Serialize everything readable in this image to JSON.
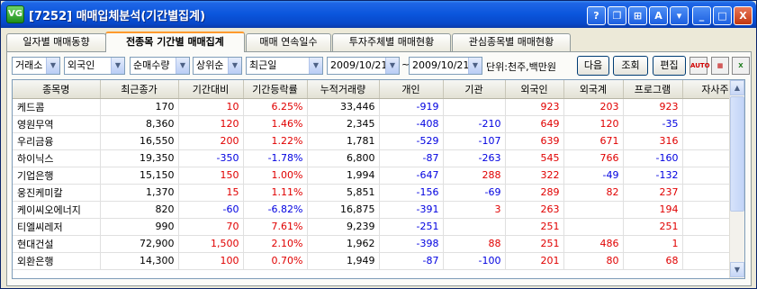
{
  "window": {
    "title": "[7252] 매매입체분석(기간별집계)",
    "app_icon_text": "VG",
    "titlebar_buttons": [
      "?",
      "❐",
      "⊞",
      "A",
      "▾",
      "_",
      "□",
      "X"
    ]
  },
  "tabs": [
    {
      "label": "일자별 매매동향",
      "active": false
    },
    {
      "label": "전종목 기간별 매매집계",
      "active": true
    },
    {
      "label": "매매 연속일수",
      "active": false
    },
    {
      "label": "투자주체별 매매현황",
      "active": false
    },
    {
      "label": "관심종목별 매매현황",
      "active": false
    }
  ],
  "filters": {
    "market": "거래소",
    "investor": "외국인",
    "sort_by": "순매수량",
    "order": "상위순",
    "period": "최근일",
    "date_from": "2009/10/21",
    "date_to": "2009/10/21",
    "tilde": "~",
    "unit_label": "단위:천주,백만원"
  },
  "buttons": {
    "next": "다음",
    "query": "조회",
    "edit": "편집",
    "auto": "AUTO"
  },
  "table": {
    "headers": [
      "종목명",
      "최근종가",
      "기간대비",
      "기간등락률",
      "누적거래량",
      "개인",
      "기관",
      "외국인",
      "외국계",
      "프로그램",
      "자사주"
    ],
    "rows": [
      {
        "name": "케드콤",
        "close": "170",
        "change": "10",
        "rate": "6.25%",
        "volume": "33,446",
        "individual": "-919",
        "institution": "",
        "foreign": "923",
        "foreign_firm": "203",
        "program": "923",
        "treasury": ""
      },
      {
        "name": "영원무역",
        "close": "8,360",
        "change": "120",
        "rate": "1.46%",
        "volume": "2,345",
        "individual": "-408",
        "institution": "-210",
        "foreign": "649",
        "foreign_firm": "120",
        "program": "-35",
        "treasury": ""
      },
      {
        "name": "우리금융",
        "close": "16,550",
        "change": "200",
        "rate": "1.22%",
        "volume": "1,781",
        "individual": "-529",
        "institution": "-107",
        "foreign": "639",
        "foreign_firm": "671",
        "program": "316",
        "treasury": ""
      },
      {
        "name": "하이닉스",
        "close": "19,350",
        "change": "-350",
        "rate": "-1.78%",
        "volume": "6,800",
        "individual": "-87",
        "institution": "-263",
        "foreign": "545",
        "foreign_firm": "766",
        "program": "-160",
        "treasury": ""
      },
      {
        "name": "기업은행",
        "close": "15,150",
        "change": "150",
        "rate": "1.00%",
        "volume": "1,994",
        "individual": "-647",
        "institution": "288",
        "foreign": "322",
        "foreign_firm": "-49",
        "program": "-132",
        "treasury": ""
      },
      {
        "name": "웅진케미칼",
        "close": "1,370",
        "change": "15",
        "rate": "1.11%",
        "volume": "5,851",
        "individual": "-156",
        "institution": "-69",
        "foreign": "289",
        "foreign_firm": "82",
        "program": "237",
        "treasury": ""
      },
      {
        "name": "케이씨오에너지",
        "close": "820",
        "change": "-60",
        "rate": "-6.82%",
        "volume": "16,875",
        "individual": "-391",
        "institution": "3",
        "foreign": "263",
        "foreign_firm": "",
        "program": "194",
        "treasury": ""
      },
      {
        "name": "티엘씨레저",
        "close": "990",
        "change": "70",
        "rate": "7.61%",
        "volume": "9,239",
        "individual": "-251",
        "institution": "",
        "foreign": "251",
        "foreign_firm": "",
        "program": "251",
        "treasury": ""
      },
      {
        "name": "현대건설",
        "close": "72,900",
        "change": "1,500",
        "rate": "2.10%",
        "volume": "1,962",
        "individual": "-398",
        "institution": "88",
        "foreign": "251",
        "foreign_firm": "486",
        "program": "1",
        "treasury": ""
      },
      {
        "name": "외환은행",
        "close": "14,300",
        "change": "100",
        "rate": "0.70%",
        "volume": "1,949",
        "individual": "-87",
        "institution": "-100",
        "foreign": "201",
        "foreign_firm": "80",
        "program": "68",
        "treasury": ""
      }
    ]
  },
  "colors": {
    "positive": "#e00000",
    "negative": "#0000e0",
    "titlebar": "#0a55dc",
    "active_tab_accent": "#ff9a2e"
  }
}
